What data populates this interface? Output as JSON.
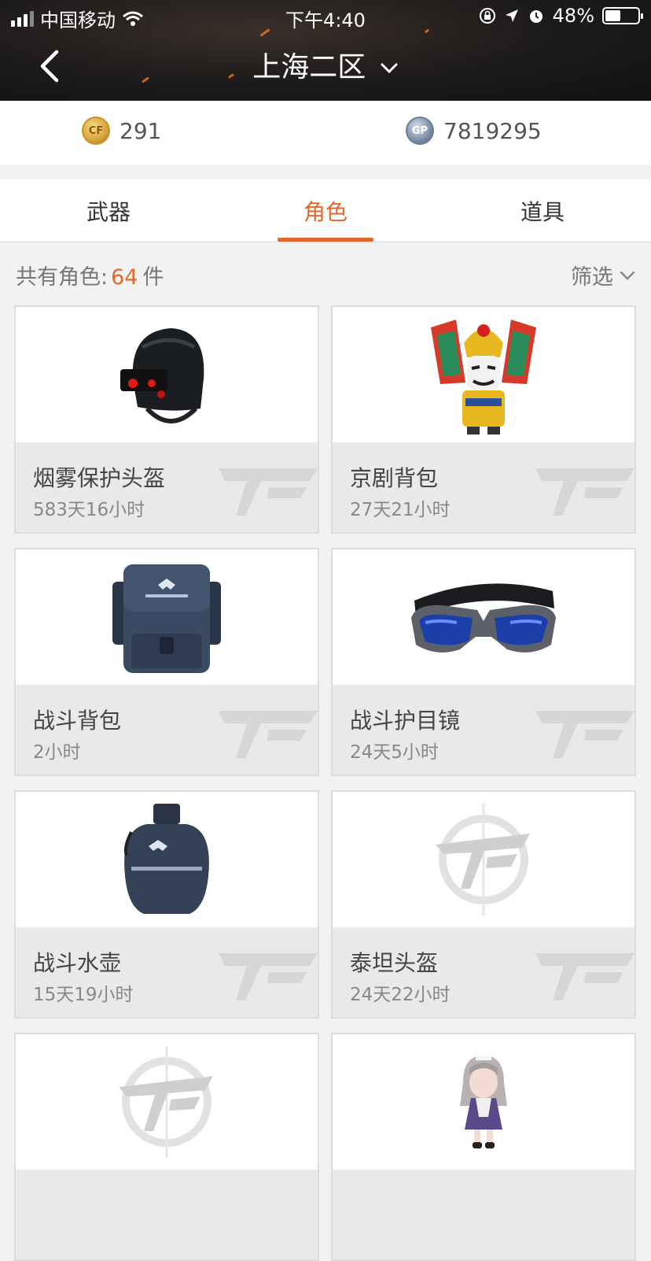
{
  "status_bar": {
    "carrier": "中国移动",
    "time": "下午4:40",
    "battery": "48%",
    "battery_level": 0.48
  },
  "header": {
    "title": "上海二区"
  },
  "currency": {
    "coin_icon_label": "CF",
    "coin_value": "291",
    "gp_icon_label": "GP",
    "gp_value": "7819295"
  },
  "tabs": [
    {
      "label": "武器"
    },
    {
      "label": "角色",
      "active": true
    },
    {
      "label": "道具"
    }
  ],
  "summary": {
    "label": "共有角色:",
    "count": "64",
    "unit": "件",
    "filter_label": "筛选"
  },
  "items": [
    {
      "name": "烟雾保护头盔",
      "duration": "583天16小时",
      "icon": "helmet-icon"
    },
    {
      "name": "京剧背包",
      "duration": "27天21小时",
      "icon": "opera-backpack-icon"
    },
    {
      "name": "战斗背包",
      "duration": "2小时",
      "icon": "backpack-icon"
    },
    {
      "name": "战斗护目镜",
      "duration": "24天5小时",
      "icon": "goggles-icon"
    },
    {
      "name": "战斗水壶",
      "duration": "15天19小时",
      "icon": "canteen-icon"
    },
    {
      "name": "泰坦头盔",
      "duration": "24天22小时",
      "icon": "cf-placeholder-icon"
    },
    {
      "name": "",
      "duration": "",
      "icon": "cf-placeholder-icon"
    },
    {
      "name": "",
      "duration": "",
      "icon": "doll-icon"
    }
  ],
  "colors": {
    "accent": "#e2672c",
    "header_bg": "#1c1a1a",
    "card_bg": "#e9e9e9"
  }
}
